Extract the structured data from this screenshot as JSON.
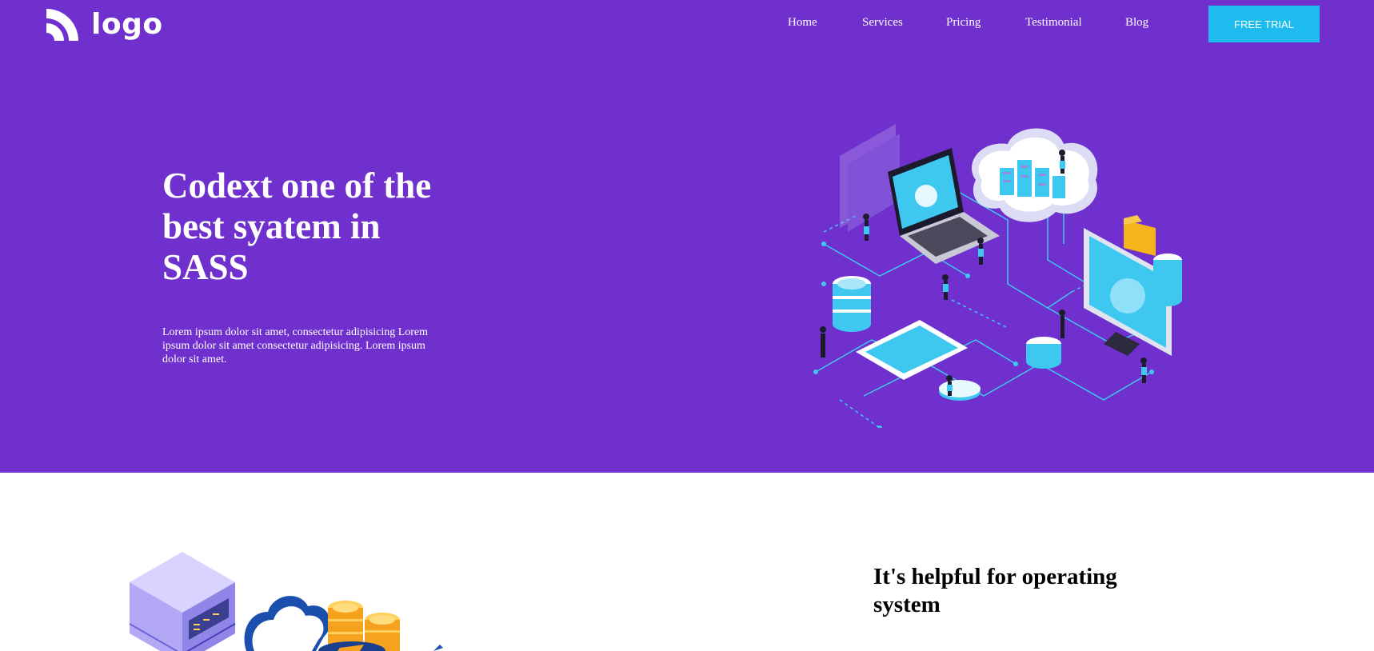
{
  "header": {
    "logo_text": "logo",
    "nav": [
      {
        "label": "Home"
      },
      {
        "label": "Services"
      },
      {
        "label": "Pricing"
      },
      {
        "label": "Testimonial"
      },
      {
        "label": "Blog"
      }
    ],
    "cta_label": "FREE TRIAL"
  },
  "hero": {
    "title": "Codext one of the best syatem in SASS",
    "description": "Lorem ipsum dolor sit amet, consectetur adipisicing Lorem ipsum dolor sit amet consectetur adipisicing. Lorem ipsum dolor sit amet.",
    "illustration_icon": "cloud-network-illustration"
  },
  "section2": {
    "title": "It's helpful for operating system",
    "illustration_icon": "server-cloud-coins-illustration"
  },
  "colors": {
    "hero_bg": "#6f30cd",
    "cta_bg": "#1ebcee",
    "accent_cyan": "#3ec8f0",
    "text_light": "#ffffff",
    "text_dark": "#000000"
  }
}
